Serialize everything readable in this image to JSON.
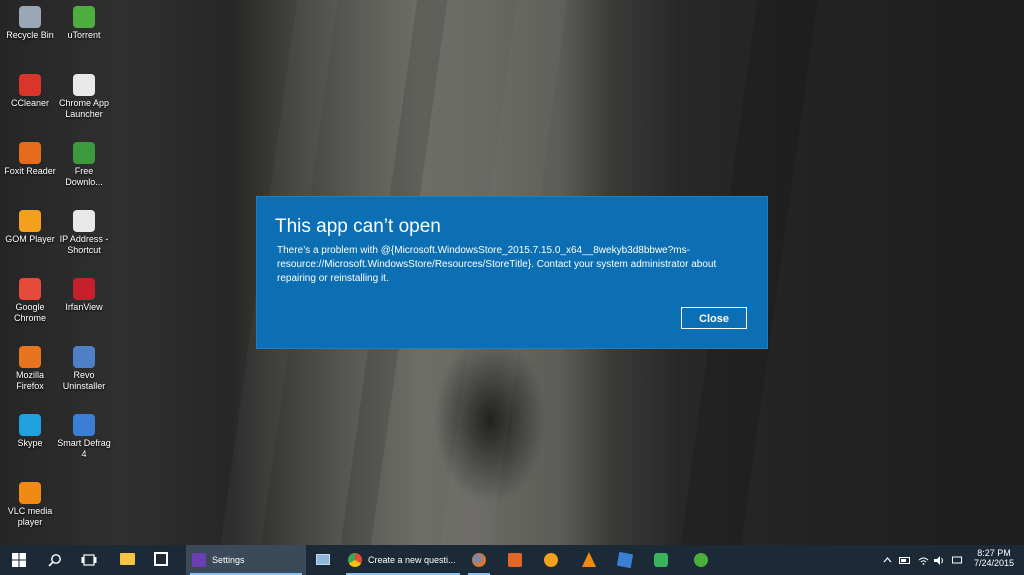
{
  "desktop": {
    "icons": [
      {
        "label": "Recycle Bin",
        "icon": "recycle-bin-icon",
        "color": "#9aa7b4"
      },
      {
        "label": "uTorrent",
        "icon": "utorrent-icon",
        "color": "#4caf3d"
      },
      {
        "label": "CCleaner",
        "icon": "ccleaner-icon",
        "color": "#d9352b"
      },
      {
        "label": "Chrome App Launcher",
        "icon": "chrome-app-launcher-icon",
        "color": "#e9e9e9"
      },
      {
        "label": "Foxit Reader",
        "icon": "foxit-reader-icon",
        "color": "#e66b1a"
      },
      {
        "label": "Free Downlo...",
        "icon": "free-download-icon",
        "color": "#3b9a3b"
      },
      {
        "label": "GOM Player",
        "icon": "gom-player-icon",
        "color": "#f3a11c"
      },
      {
        "label": "IP Address - Shortcut",
        "icon": "document-icon",
        "color": "#e8e8e8"
      },
      {
        "label": "Google Chrome",
        "icon": "google-chrome-icon",
        "color": "#e54a3b"
      },
      {
        "label": "IrfanView",
        "icon": "irfanview-icon",
        "color": "#c8202a"
      },
      {
        "label": "Mozilla Firefox",
        "icon": "firefox-icon",
        "color": "#e8741f"
      },
      {
        "label": "Revo Uninstaller",
        "icon": "revo-uninstaller-icon",
        "color": "#4f7fc6"
      },
      {
        "label": "Skype",
        "icon": "skype-icon",
        "color": "#1fa1e0"
      },
      {
        "label": "Smart Defrag 4",
        "icon": "smart-defrag-icon",
        "color": "#3b7fd4"
      },
      {
        "label": "VLC media player",
        "icon": "vlc-icon",
        "color": "#f08a12"
      }
    ]
  },
  "dialog": {
    "title": "This app can’t open",
    "message": "There’s a problem with @{Microsoft.WindowsStore_2015.7.15.0_x64__8wekyb3d8bbwe?ms-resource://Microsoft.WindowsStore/Resources/StoreTitle}. Contact your system administrator about repairing or reinstalling it.",
    "close_label": "Close",
    "bg_color": "#0c6fb3"
  },
  "taskbar": {
    "settings_label": "Settings",
    "chrome_label": "Create a new questi...",
    "time": "8:27 PM",
    "date": "7/24/2015",
    "bg_color": "#1b2a36"
  }
}
